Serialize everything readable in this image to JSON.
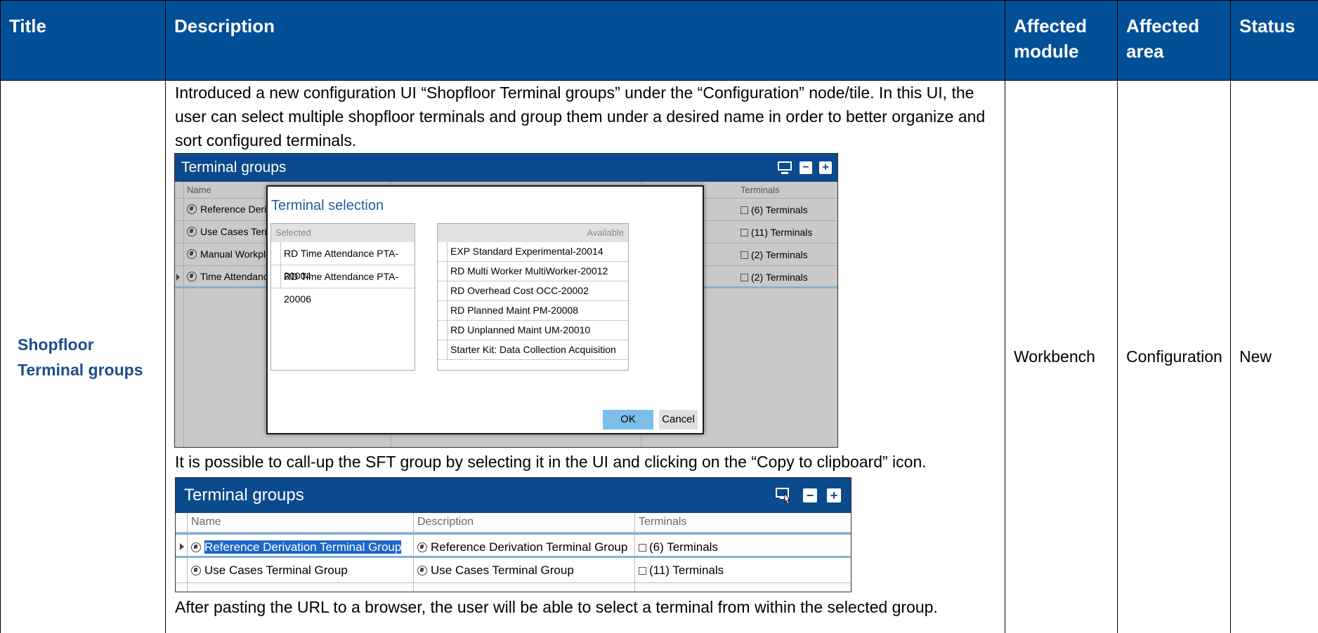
{
  "table": {
    "headers": {
      "title": "Title",
      "description": "Description",
      "module": "Affected module",
      "area": "Affected area",
      "status": "Status"
    },
    "row": {
      "title": "Shopfloor Terminal groups",
      "intro": "Introduced a new configuration UI “Shopfloor Terminal groups” under the “Configuration” node/tile. In this UI, the user can select multiple shopfloor terminals and group them under a desired name in order to better organize and sort configured terminals.",
      "middle": "It is possible to call-up the SFT group by selecting it in the UI and clicking on the “Copy to clipboard” icon.",
      "outro": "After pasting the URL to a browser, the user will be able to select a terminal from within the selected group.",
      "module": "Workbench",
      "area": "Configuration",
      "status": "New"
    }
  },
  "shot1": {
    "title": "Terminal groups",
    "col_name": "Name",
    "col_terminals": "Terminals",
    "rows": [
      {
        "name": "Reference Derivat",
        "terminals": "(6) Terminals"
      },
      {
        "name": "Use Cases Termin",
        "terminals": "(11) Terminals"
      },
      {
        "name": "Manual Workplac",
        "terminals": "(2) Terminals"
      },
      {
        "name": "Time Attendance",
        "terminals": "(2) Terminals"
      }
    ],
    "dialog": {
      "title": "Terminal selection",
      "selected_label": "Selected",
      "available_label": "Available",
      "selected": [
        "RD Time Attendance PTA-20004",
        "RD Time Attendance PTA-20006"
      ],
      "available": [
        "EXP Standard Experimental-20014",
        "RD Multi Worker MultiWorker-20012",
        "RD Overhead Cost OCC-20002",
        "RD Planned Maint PM-20008",
        "RD Unplanned Maint UM-20010",
        "Starter Kit: Data Collection Acquisition"
      ],
      "arrows": [
        "«",
        "‹",
        "›",
        "»"
      ],
      "ok": "OK",
      "cancel": "Cancel"
    },
    "icons": [
      "monitor-icon",
      "minus-icon",
      "plus-icon"
    ]
  },
  "shot2": {
    "title": "Terminal groups",
    "col_name": "Name",
    "col_description": "Description",
    "col_terminals": "Terminals",
    "rows": [
      {
        "name": "Reference Derivation Terminal Group",
        "description": "Reference Derivation Terminal Group",
        "terminals": "(6) Terminals"
      },
      {
        "name": "Use Cases Terminal Group",
        "description": "Use Cases Terminal Group",
        "terminals": "(11) Terminals"
      }
    ],
    "icons": [
      "copy-to-clipboard-icon",
      "minus-icon",
      "plus-icon"
    ]
  },
  "colors": {
    "header_bg": "#004f97",
    "title_text": "#1f4e8c",
    "app_header": "#0b4a8c",
    "selection": "#1e66c8"
  }
}
